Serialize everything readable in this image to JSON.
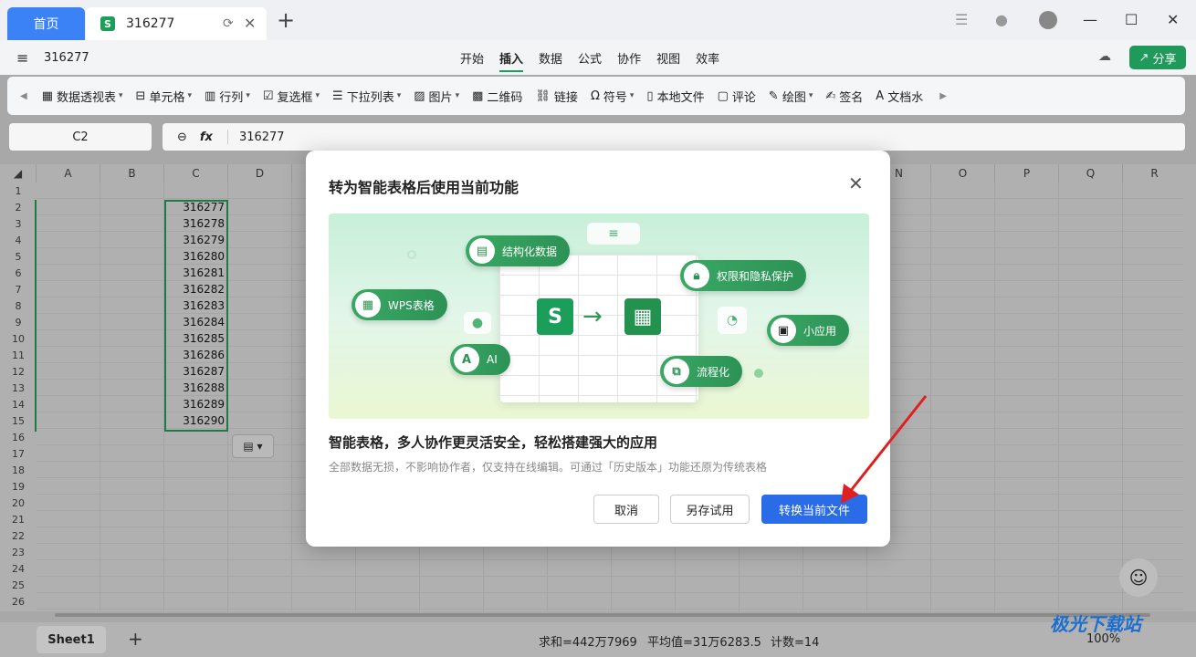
{
  "tabs": {
    "home_label": "首页",
    "doc_label": "316277"
  },
  "topbar": {
    "doc_name": "316277",
    "menus": [
      "开始",
      "插入",
      "数据",
      "公式",
      "协作",
      "视图",
      "效率"
    ],
    "active_menu": "插入",
    "share_label": "分享"
  },
  "ribbon": {
    "items": [
      {
        "icon": "pivot-icon",
        "label": "数据透视表",
        "dropdown": true
      },
      {
        "icon": "cell-icon",
        "label": "单元格",
        "dropdown": true
      },
      {
        "icon": "rowcol-icon",
        "label": "行列",
        "dropdown": true
      },
      {
        "icon": "checkbox-icon",
        "label": "复选框",
        "dropdown": true
      },
      {
        "icon": "dropdown-list-icon",
        "label": "下拉列表",
        "dropdown": true
      },
      {
        "icon": "image-icon",
        "label": "图片",
        "dropdown": true
      },
      {
        "icon": "qrcode-icon",
        "label": "二维码",
        "dropdown": false
      },
      {
        "icon": "link-icon",
        "label": "链接",
        "dropdown": false
      },
      {
        "icon": "omega-icon",
        "label": "符号",
        "dropdown": true
      },
      {
        "icon": "file-icon",
        "label": "本地文件",
        "dropdown": false
      },
      {
        "icon": "comment-icon",
        "label": "评论",
        "dropdown": false
      },
      {
        "icon": "draw-icon",
        "label": "绘图",
        "dropdown": true
      },
      {
        "icon": "sign-icon",
        "label": "签名",
        "dropdown": false
      },
      {
        "icon": "watermark-icon",
        "label": "文档水",
        "dropdown": false
      }
    ]
  },
  "formula": {
    "cell_ref": "C2",
    "fx_label": "fx",
    "value": "316277"
  },
  "grid": {
    "columns": [
      "A",
      "B",
      "C",
      "D",
      "E",
      "F",
      "G",
      "H",
      "I",
      "J",
      "K",
      "L",
      "M",
      "N",
      "O",
      "P",
      "Q",
      "R"
    ],
    "rows": [
      "1",
      "2",
      "3",
      "4",
      "5",
      "6",
      "7",
      "8",
      "9",
      "10",
      "11",
      "12",
      "13",
      "14",
      "15",
      "16",
      "17",
      "18",
      "19",
      "20",
      "21",
      "22",
      "23",
      "24",
      "25",
      "26"
    ],
    "c_values": [
      "316277",
      "316278",
      "316279",
      "316280",
      "316281",
      "316282",
      "316283",
      "316284",
      "316285",
      "316286",
      "316287",
      "316288",
      "316289",
      "316290"
    ]
  },
  "statusbar": {
    "sheet_name": "Sheet1",
    "sum": "求和=442万7969",
    "avg": "平均值=31万6283.5",
    "count": "计数=14",
    "zoom": "100%"
  },
  "dialog": {
    "title": "转为智能表格后使用当前功能",
    "hero_pills": [
      "结构化数据",
      "WPS表格",
      "AI",
      "权限和隐私保护",
      "小应用",
      "流程化"
    ],
    "headline": "智能表格，多人协作更灵活安全，轻松搭建强大的应用",
    "description": "全部数据无损，不影响协作者，仅支持在线编辑。可通过「历史版本」功能还原为传统表格",
    "cancel_label": "取消",
    "save_as_label": "另存试用",
    "convert_label": "转换当前文件"
  },
  "watermark": "极光下载站",
  "colors": {
    "accent_green": "#1f9a5a",
    "primary_blue": "#2a6be8",
    "home_tab_blue": "#3b82f6",
    "arrow_red": "#e02020"
  }
}
